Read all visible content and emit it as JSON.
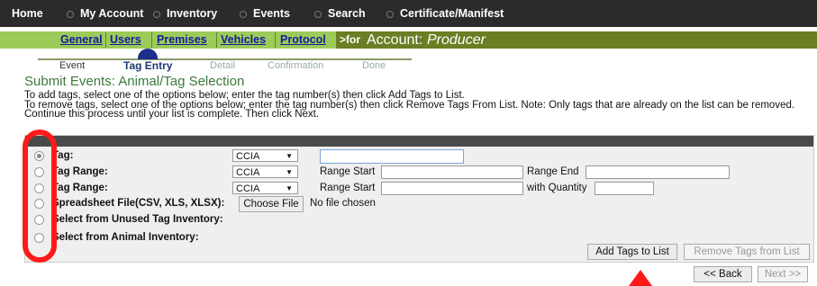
{
  "topnav": {
    "items": [
      "Home",
      "My Account",
      "Inventory",
      "Events",
      "Search",
      "Certificate/Manifest"
    ]
  },
  "subnav": {
    "links": [
      "General",
      "Users",
      "Premises",
      "Vehicles",
      "Protocol"
    ],
    "prefix": ">for",
    "account_label": "Account:",
    "account_name": "Producer"
  },
  "wizard": {
    "steps": [
      "Event",
      "Tag Entry",
      "Detail",
      "Confirmation",
      "Done"
    ],
    "active_step": "Tag Entry"
  },
  "page": {
    "title": "Submit Events: Animal/Tag Selection",
    "instructions": [
      "To add tags, select one of the options below; enter the tag number(s) then click Add Tags to List.",
      "To remove tags, select one of the options below; enter the tag number(s) then click Remove Tags From List. Note: Only tags that are already on the list can be removed.",
      "Continue this process until your list is complete. Then click Next."
    ]
  },
  "form": {
    "rows": [
      {
        "label": "Tag:",
        "checked": true
      },
      {
        "label": "Tag Range:",
        "checked": false
      },
      {
        "label": "Tag Range:",
        "checked": false
      },
      {
        "label": "Spreadsheet File(CSV, XLS, XLSX):",
        "checked": false
      },
      {
        "label": "Select from Unused Tag Inventory:",
        "checked": false
      },
      {
        "label": "Select from Animal Inventory:",
        "checked": false
      }
    ],
    "tag_type": "CCIA",
    "range_start_label": "Range Start",
    "range_end_label": "Range End",
    "with_quantity_label": "with Quantity",
    "choose_file_label": "Choose File",
    "no_file_text": "No file chosen"
  },
  "buttons": {
    "add": "Add Tags to List",
    "remove": "Remove Tags from List",
    "back": "<< Back",
    "next": "Next >>"
  },
  "colors": {
    "topnav_bg": "#2b2b2b",
    "subnav_bg": "#9ccb5a",
    "account_bg": "#6b7e24",
    "title_green": "#3a7a3a",
    "annotation_red": "#ff1a1a"
  }
}
